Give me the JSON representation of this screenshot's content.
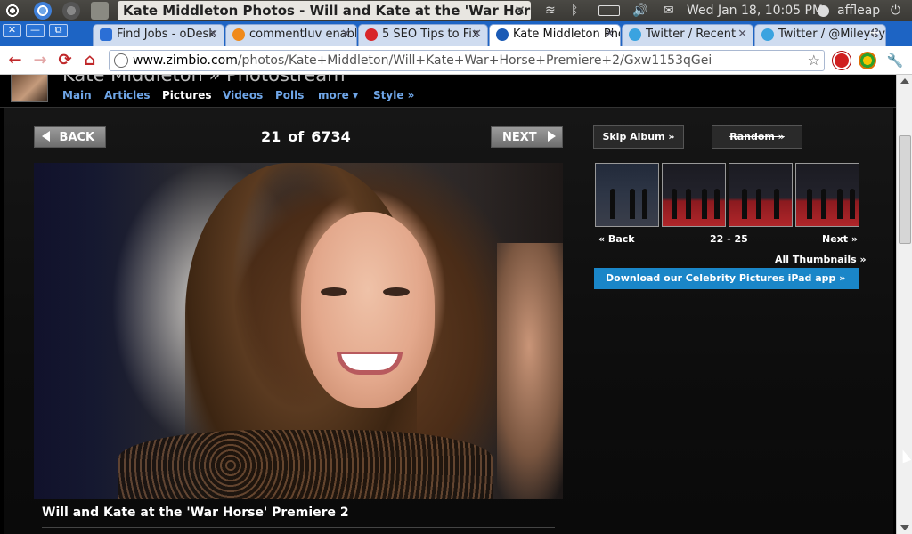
{
  "panel": {
    "window_title": "Kate Middleton Photos - Will and Kate at the 'War Hors...",
    "close_glyph": "✕",
    "datetime": "Wed Jan 18, 10:05 PM",
    "user": "affleap"
  },
  "tabs": [
    {
      "label": "Find Jobs - oDesk",
      "fav_color": "#2b6fd6"
    },
    {
      "label": "commentluv enabled",
      "fav_color": "#f08a1c"
    },
    {
      "label": "5 SEO Tips to Fix",
      "fav_color": "#d8262a"
    },
    {
      "label": "Kate Middleton Photos",
      "fav_color": "#1a5ab5",
      "active": true
    },
    {
      "label": "Twitter / Recent",
      "fav_color": "#3aa3e0"
    },
    {
      "label": "Twitter / @MileyCyrus",
      "fav_color": "#3aa3e0"
    }
  ],
  "tab_close": "✕",
  "new_tab_glyph": "+",
  "window_buttons": {
    "close": "✕",
    "minimize": "—",
    "restore": "⧉"
  },
  "toolbar": {
    "back_glyph": "←",
    "forward_glyph": "→",
    "reload_glyph": "⟳",
    "home_glyph": "⌂",
    "url_host": "www.zimbio.com",
    "url_path": "/photos/Kate+Middleton/Will+Kate+War+Horse+Premiere+2/Gxw1153qGei",
    "star_glyph": "☆",
    "wrench_glyph": "🔧"
  },
  "site": {
    "breadcrumb": "Kate Middleton  »  Photostream",
    "nav": [
      "Main",
      "Articles",
      "Pictures",
      "Videos",
      "Polls",
      "more ▾",
      "Style »"
    ],
    "current_nav": "Pictures"
  },
  "viewer": {
    "back_label": "BACK",
    "next_label": "NEXT",
    "current_index": "21",
    "of_label": "of",
    "total": "6734",
    "skip_album": "Skip Album »",
    "random": "Random »",
    "caption": "Will and Kate at the 'War Horse' Premiere 2"
  },
  "thumbs": {
    "back": "« Back",
    "range": "22 - 25",
    "next": "Next »",
    "all": "All Thumbnails »",
    "ipad": "Download our Celebrity Pictures iPad app »"
  },
  "colors": {
    "accent_blue": "#1a86c8",
    "tab_blue": "#1d64c4",
    "nav_link": "#6fa6e8"
  }
}
